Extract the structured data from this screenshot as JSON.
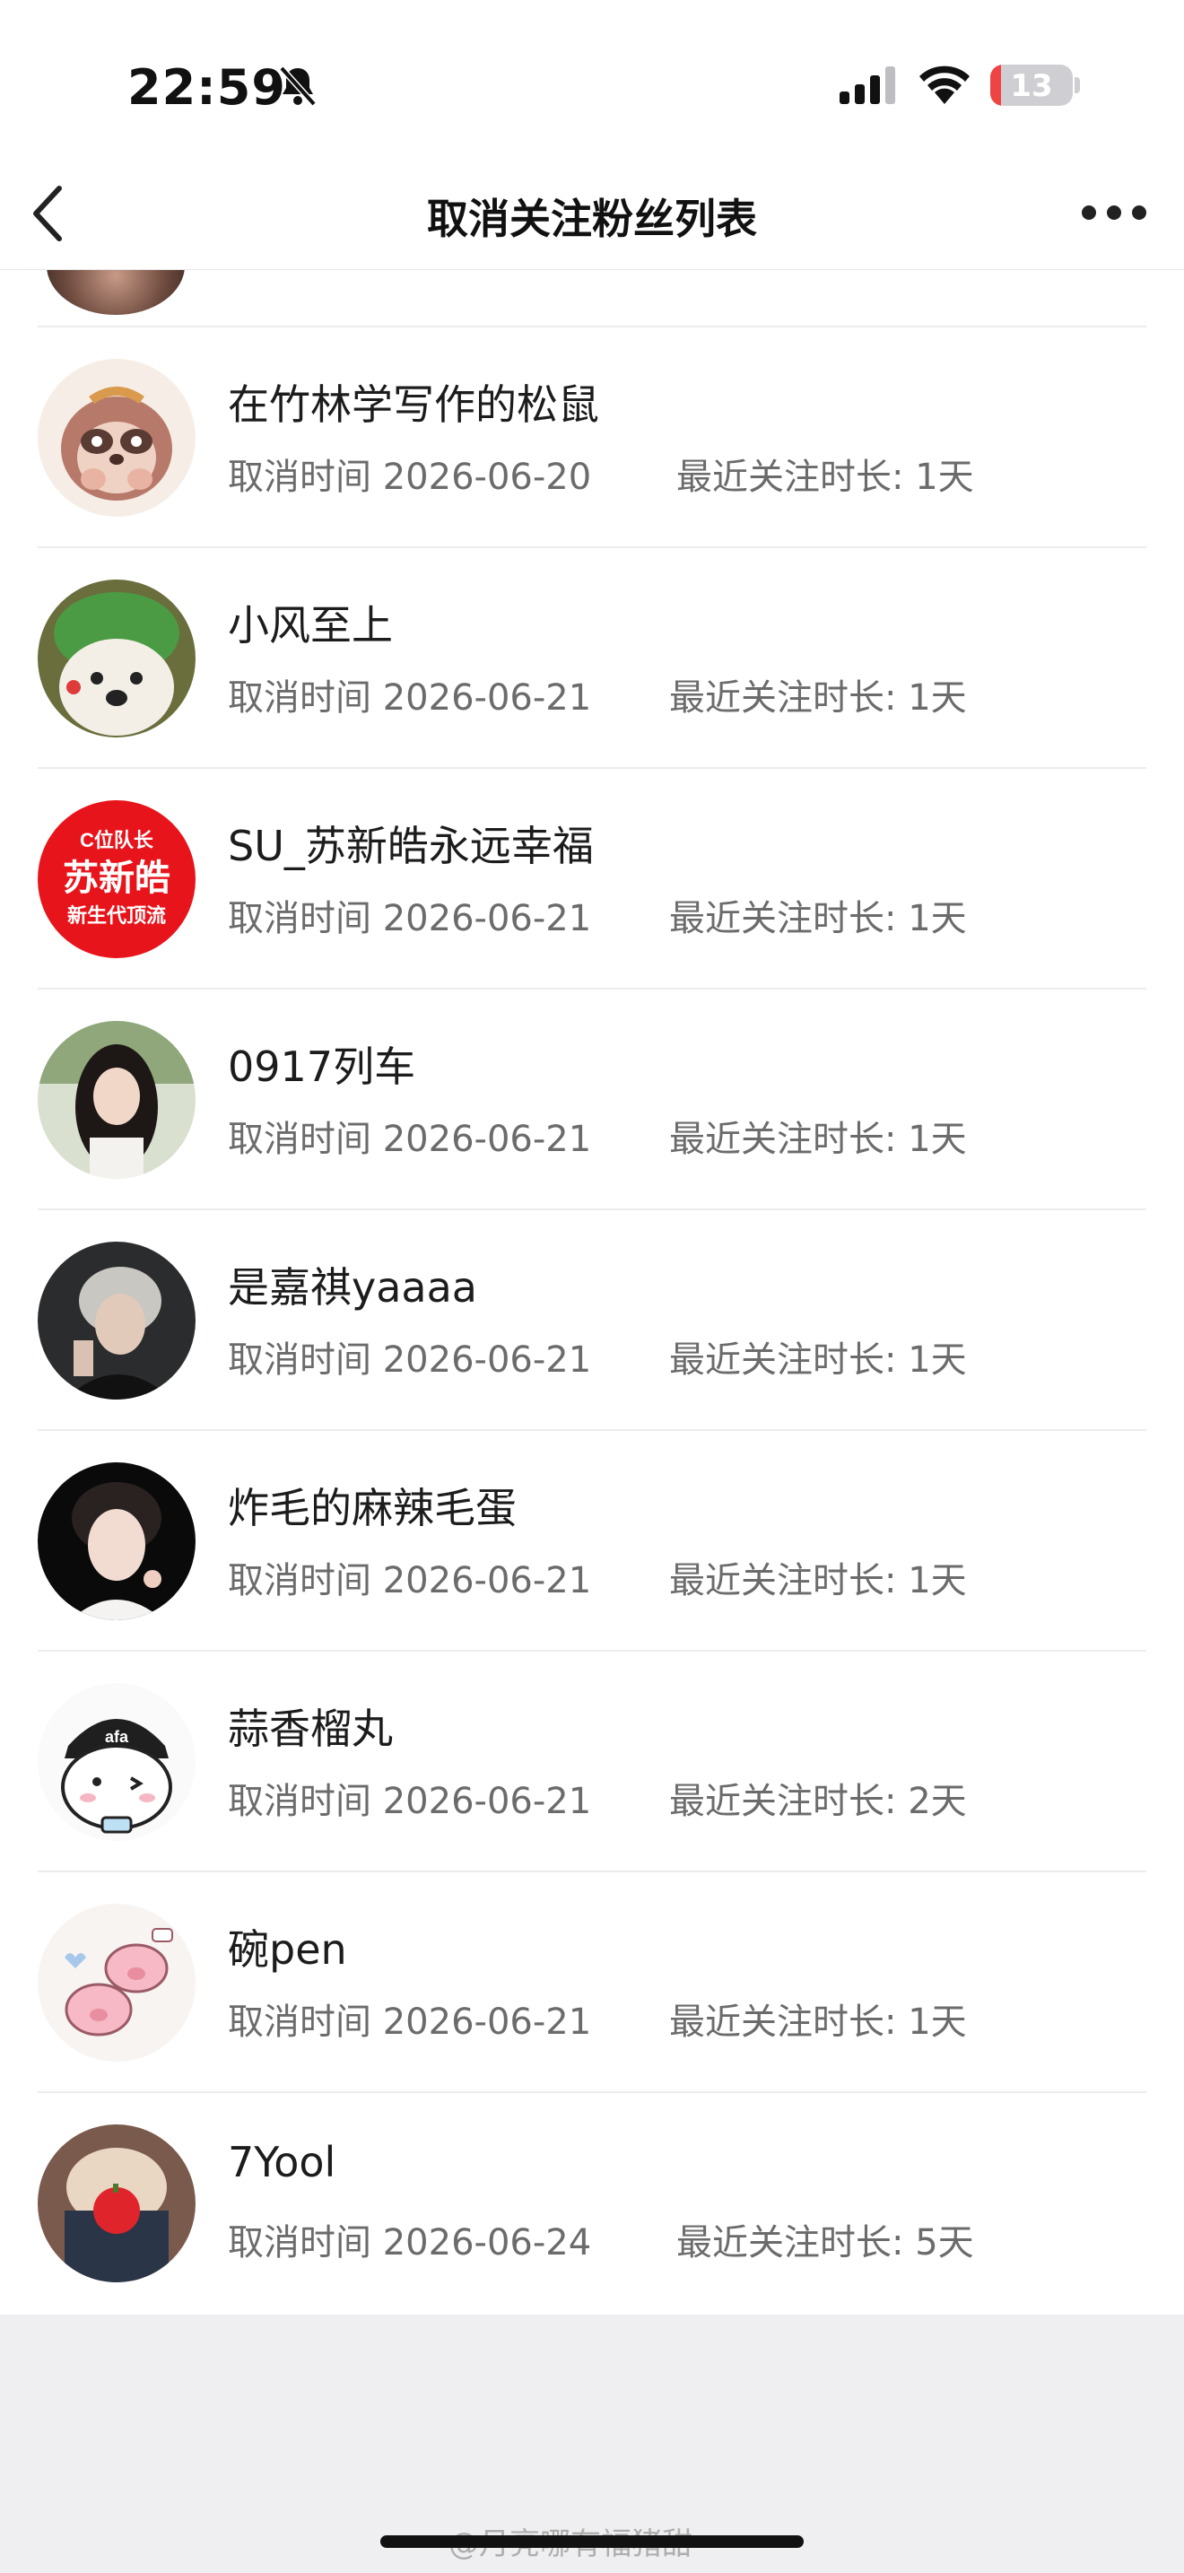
{
  "status_bar": {
    "time": "22:59",
    "battery_level": "13",
    "battery_fraction": 0.13,
    "icons": [
      "bell-slash-icon",
      "signal-icon",
      "wifi-icon",
      "battery-icon"
    ]
  },
  "nav": {
    "title": "取消关注粉丝列表",
    "back_icon": "chevron-left-icon",
    "more_icon": "more-horizontal-icon"
  },
  "list": {
    "items": [
      {
        "name": "在竹林学写作的松鼠",
        "cancel_label": "取消时间",
        "cancel_date": "2026-06-20",
        "duration_label": "最近关注时长:",
        "duration": "1天"
      },
      {
        "name": "小风至上",
        "cancel_label": "取消时间",
        "cancel_date": "2026-06-21",
        "duration_label": "最近关注时长:",
        "duration": "1天"
      },
      {
        "name": "SU_苏新皓永远幸福",
        "cancel_label": "取消时间",
        "cancel_date": "2026-06-21",
        "duration_label": "最近关注时长:",
        "duration": "1天",
        "avatar_text": [
          "C位队长",
          "苏新皓",
          "新生代顶流"
        ]
      },
      {
        "name": "0917列车",
        "cancel_label": "取消时间",
        "cancel_date": "2026-06-21",
        "duration_label": "最近关注时长:",
        "duration": "1天"
      },
      {
        "name": "是嘉祺yaaaa",
        "cancel_label": "取消时间",
        "cancel_date": "2026-06-21",
        "duration_label": "最近关注时长:",
        "duration": "1天"
      },
      {
        "name": "炸毛的麻辣毛蛋",
        "cancel_label": "取消时间",
        "cancel_date": "2026-06-21",
        "duration_label": "最近关注时长:",
        "duration": "1天"
      },
      {
        "name": "蒜香榴丸",
        "cancel_label": "取消时间",
        "cancel_date": "2026-06-21",
        "duration_label": "最近关注时长:",
        "duration": "2天"
      },
      {
        "name": "碗pen",
        "cancel_label": "取消时间",
        "cancel_date": "2026-06-21",
        "duration_label": "最近关注时长:",
        "duration": "1天"
      },
      {
        "name": "7Yool",
        "cancel_label": "取消时间",
        "cancel_date": "2026-06-24",
        "duration_label": "最近关注时长:",
        "duration": "5天"
      }
    ]
  },
  "watermark": "@月亮哪有福猪甜"
}
